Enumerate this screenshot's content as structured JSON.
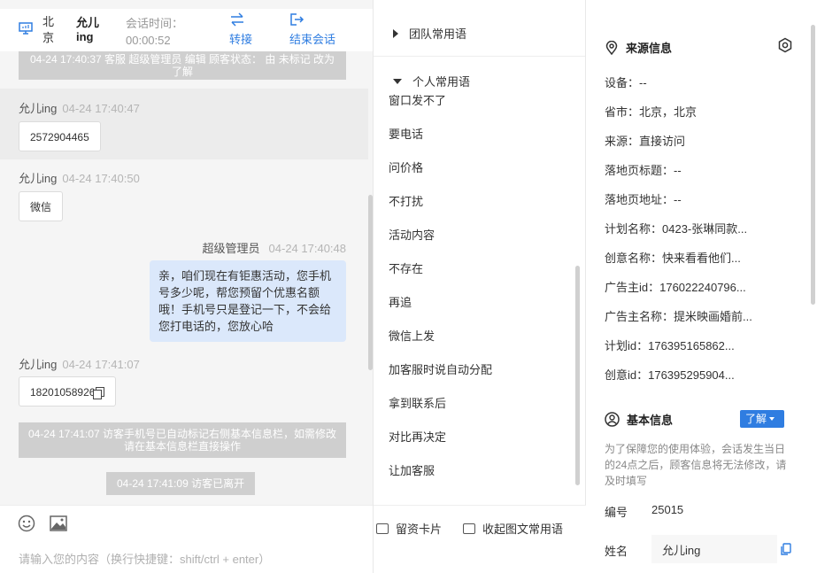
{
  "header": {
    "city": "北京",
    "visitor_name": "允儿ing",
    "time_label": "会话时间：",
    "time_value": "00:00:52",
    "transfer_label": "转接",
    "end_label": "结束会话"
  },
  "messages": {
    "sys1": "04-24 17:40:37 客服 超级管理员 编辑 顾客状态： 由 未标记 改为 了解",
    "m1_sender": "允儿ing",
    "m1_time": "04-24 17:40:47",
    "m1_text": "2572904465",
    "m2_sender": "允儿ing",
    "m2_time": "04-24 17:40:50",
    "m2_text": "微信",
    "agent_name": "超级管理员",
    "agent_time": "04-24 17:40:48",
    "agent_text": "亲，咱们现在有钜惠活动，您手机号多少呢，帮您预留个优惠名额哦！手机号只是登记一下，不会给您打电话的，您放心哈",
    "m3_sender": "允儿ing",
    "m3_time": "04-24 17:41:07",
    "m3_text": "18201058926",
    "sys2": "04-24 17:41:07 访客手机号已自动标记右侧基本信息栏，如需修改请在基本信息栏直接操作",
    "sys3": "04-24 17:41:09 访客已离开"
  },
  "input": {
    "placeholder": "请输入您的内容（换行快捷键：shift/ctrl + enter）",
    "leave_card": "留资卡片",
    "collapse_phrases": "收起图文常用语"
  },
  "phrases": {
    "team_title": "团队常用语",
    "personal_title": "个人常用语",
    "items": [
      "窗口发不了",
      "要电话",
      "问价格",
      "不打扰",
      "活动内容",
      "不存在",
      "再追",
      "微信上发",
      "加客服时说自动分配",
      "拿到联系后",
      "对比再决定",
      "让加客服"
    ]
  },
  "source_info": {
    "title": "来源信息",
    "rows": [
      "设备：--",
      "省市：北京，北京",
      "来源：直接访问",
      "落地页标题：--",
      "落地页地址：--",
      "计划名称：0423-张琳同款...",
      "创意名称：快来看看他们...",
      "广告主id：176022240796...",
      "广告主名称：提米映画婚前...",
      "计划id：176395165862...",
      "创意id：176395295904..."
    ]
  },
  "basic_info": {
    "title": "基本信息",
    "status_badge": "了解",
    "note": "为了保障您的使用体验，会话发生当日的24点之后，顾客信息将无法修改，请及时填写",
    "id_label": "编号",
    "id_value": "25015",
    "name_label": "姓名",
    "name_value": "允儿ing"
  },
  "colors": {
    "accent": "#2f7de1",
    "agent_bubble": "#dbe8fb",
    "system_msg": "#cfcfcf"
  }
}
